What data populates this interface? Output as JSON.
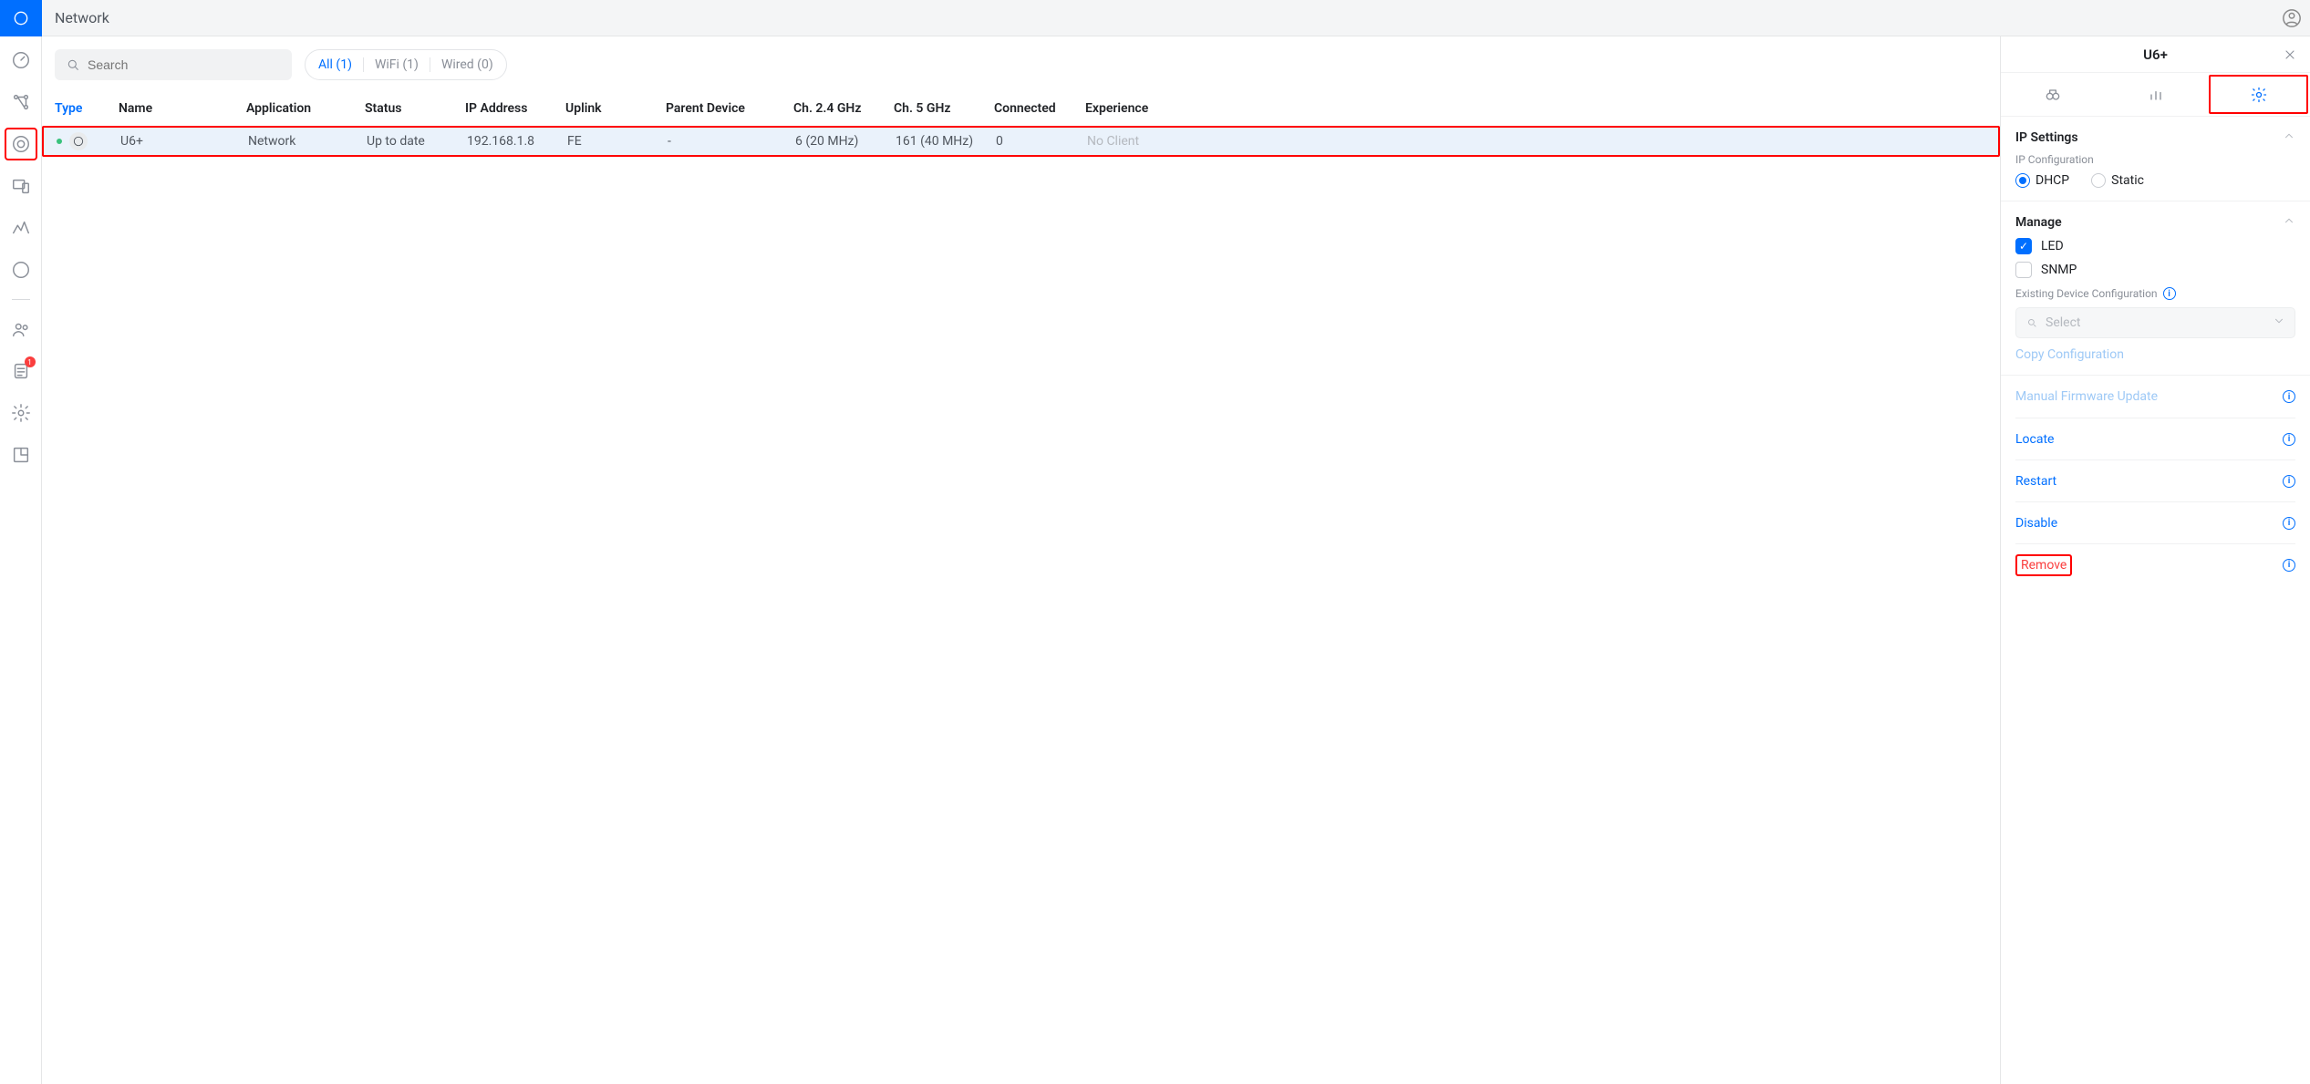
{
  "header": {
    "title": "Network"
  },
  "sidebar": {
    "items": [
      {
        "name": "dashboard",
        "badge": null
      },
      {
        "name": "topology",
        "badge": null
      },
      {
        "name": "unifi-devices",
        "badge": null,
        "active": true
      },
      {
        "name": "client-devices",
        "badge": null
      },
      {
        "name": "statistics",
        "badge": null
      },
      {
        "name": "wifi-insights",
        "badge": null
      },
      {
        "name": "separator",
        "badge": null
      },
      {
        "name": "users",
        "badge": null
      },
      {
        "name": "system-log",
        "badge": "1"
      },
      {
        "name": "settings",
        "badge": null
      },
      {
        "name": "placeholder",
        "badge": null
      }
    ]
  },
  "toolbar": {
    "search_placeholder": "Search",
    "filters": [
      {
        "label": "All (1)",
        "active": true
      },
      {
        "label": "WiFi (1)",
        "active": false
      },
      {
        "label": "Wired (0)",
        "active": false
      }
    ]
  },
  "table": {
    "headers": [
      "Type",
      "Name",
      "Application",
      "Status",
      "IP Address",
      "Uplink",
      "Parent Device",
      "Ch. 2.4 GHz",
      "Ch. 5 GHz",
      "Connected",
      "Experience"
    ],
    "rows": [
      {
        "name": "U6+",
        "application": "Network",
        "status": "Up to date",
        "ip": "192.168.1.8",
        "uplink": "FE",
        "parent": "-",
        "ch24": "6 (20 MHz)",
        "ch5": "161 (40 MHz)",
        "connected": "0",
        "experience": "No Client"
      }
    ]
  },
  "details": {
    "title": "U6+",
    "tabs": [
      "overview",
      "insights",
      "settings"
    ],
    "ip_settings": {
      "title": "IP Settings",
      "config_label": "IP Configuration",
      "dhcp_label": "DHCP",
      "static_label": "Static",
      "selected": "dhcp"
    },
    "manage": {
      "title": "Manage",
      "led_label": "LED",
      "led_checked": true,
      "snmp_label": "SNMP",
      "snmp_checked": false,
      "existing_label": "Existing Device Configuration",
      "select_placeholder": "Select",
      "copy_label": "Copy Configuration"
    },
    "actions": {
      "firmware": "Manual Firmware Update",
      "locate": "Locate",
      "restart": "Restart",
      "disable": "Disable",
      "remove": "Remove"
    }
  }
}
